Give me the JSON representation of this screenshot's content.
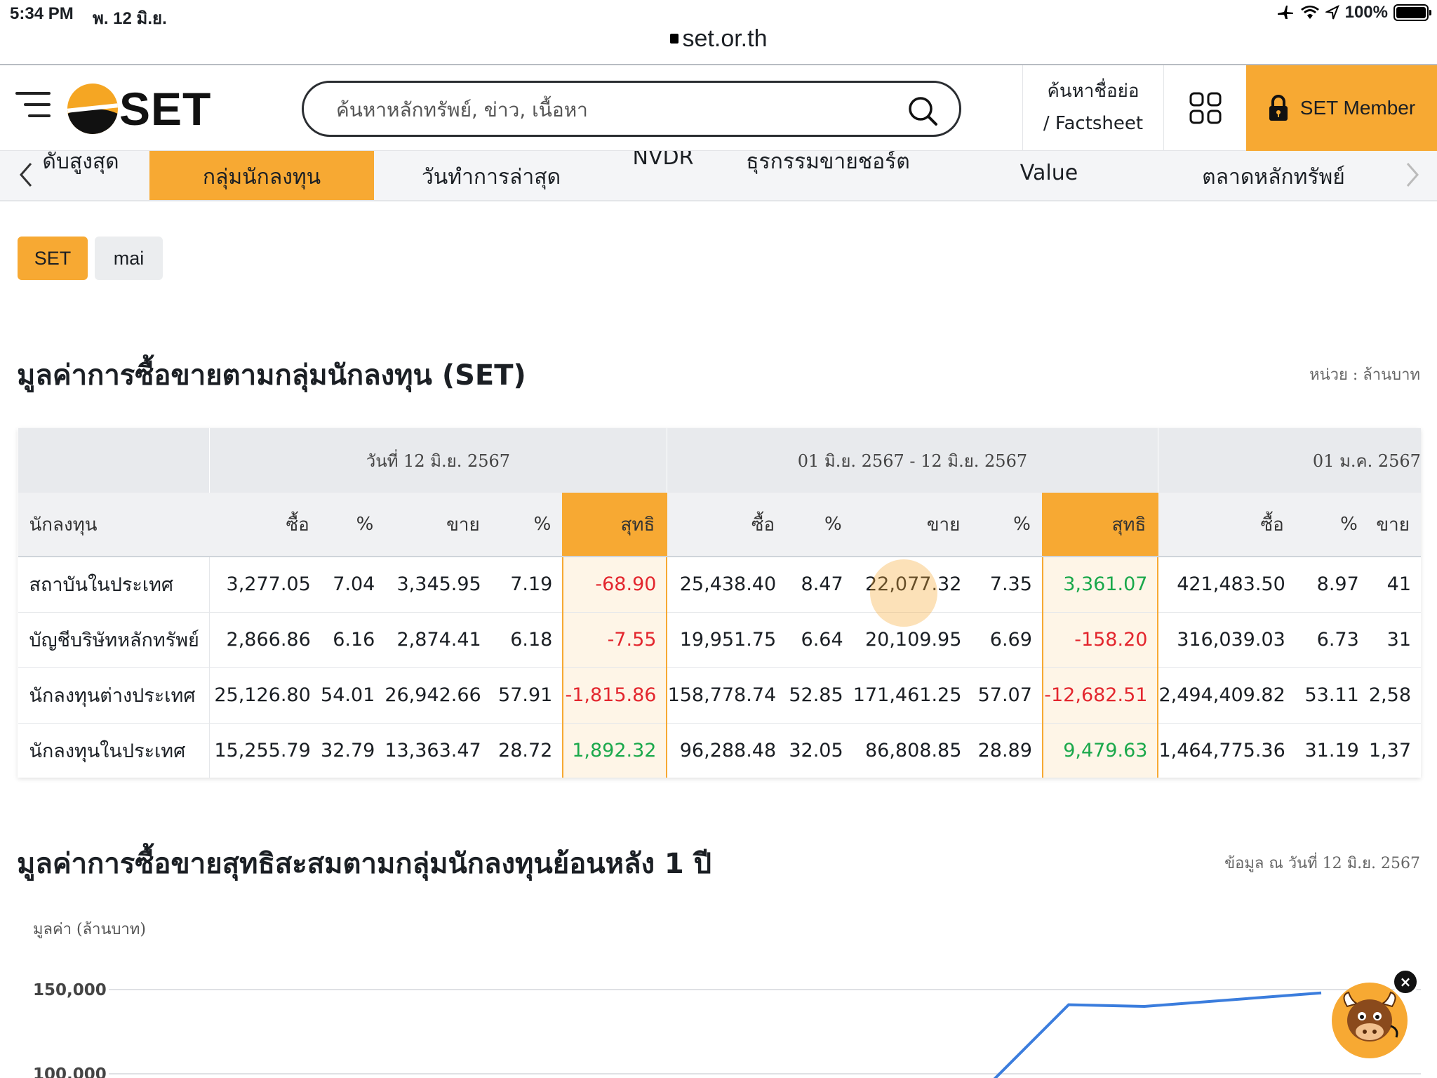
{
  "status_bar": {
    "time": "5:34 PM",
    "date": "พ. 12 มิ.ย.",
    "battery": "100%"
  },
  "browser": {
    "url": "set.or.th"
  },
  "header": {
    "logo_text": "SET",
    "search_placeholder": "ค้นหาหลักทรัพย์, ข่าว, เนื้อหา",
    "factsheet_line1": "ค้นหาชื่อย่อ",
    "factsheet_line2": "/ Factsheet",
    "member_label": "SET Member",
    "accent": "#f7a933"
  },
  "tabs": [
    {
      "top": "",
      "bottom": "ดับสูงสุด"
    },
    {
      "top": "",
      "bottom": "กลุ่มนักลงทุน",
      "active": true
    },
    {
      "top": "",
      "bottom": "วันทำการล่าสุด"
    },
    {
      "top": "",
      "bottom": "NVDR"
    },
    {
      "top": "",
      "bottom": "ธุรกรรมขายชอร์ต"
    },
    {
      "top": "",
      "bottom": "Value"
    },
    {
      "top": "",
      "bottom": "ตลาดหลักทรัพย์"
    }
  ],
  "market_toggle": {
    "set": "SET",
    "mai": "mai"
  },
  "table_section": {
    "title": "มูลค่าการซื้อขายตามกลุ่มนักลงทุน (SET)",
    "unit_note": "หน่วย : ล้านบาท",
    "groups": [
      "วันที่ 12 มิ.ย. 2567",
      "01 มิ.ย. 2567 - 12 มิ.ย. 2567",
      "01 ม.ค. 2567"
    ],
    "columns": [
      "นักลงทุน",
      "ซื้อ",
      "%",
      "ขาย",
      "%",
      "สุทธิ",
      "ซื้อ",
      "%",
      "ขาย",
      "%",
      "สุทธิ",
      "ซื้อ",
      "%",
      "ขาย"
    ],
    "rows": [
      [
        "สถาบันในประเทศ",
        "3,277.05",
        "7.04",
        "3,345.95",
        "7.19",
        "-68.90",
        "25,438.40",
        "8.47",
        "22,077.32",
        "7.35",
        "3,361.07",
        "421,483.50",
        "8.97",
        "41"
      ],
      [
        "บัญชีบริษัทหลักทรัพย์",
        "2,866.86",
        "6.16",
        "2,874.41",
        "6.18",
        "-7.55",
        "19,951.75",
        "6.64",
        "20,109.95",
        "6.69",
        "-158.20",
        "316,039.03",
        "6.73",
        "31"
      ],
      [
        "นักลงทุนต่างประเทศ",
        "25,126.80",
        "54.01",
        "26,942.66",
        "57.91",
        "-1,815.86",
        "158,778.74",
        "52.85",
        "171,461.25",
        "57.07",
        "-12,682.51",
        "2,494,409.82",
        "53.11",
        "2,58"
      ],
      [
        "นักลงทุนในประเทศ",
        "15,255.79",
        "32.79",
        "13,363.47",
        "28.72",
        "1,892.32",
        "96,288.48",
        "32.05",
        "86,808.85",
        "28.89",
        "9,479.63",
        "1,464,775.36",
        "31.19",
        "1,37"
      ]
    ],
    "net_colors": {
      "negative": "#e3262e",
      "positive": "#1aa84b"
    }
  },
  "chart_section": {
    "title": "มูลค่าการซื้อขายสุทธิสะสมตามกลุ่มนักลงทุนย้อนหลัง 1 ปี",
    "as_of_note": "ข้อมูล ณ วันที่ 12 มิ.ย. 2567",
    "ylabel": "มูลค่า (ล้านบาท)",
    "tick_150000": "150,000",
    "tick_100000": "100,000"
  },
  "chart_data": {
    "type": "line",
    "title": "",
    "xlabel": "",
    "ylabel": "มูลค่า (ล้านบาท)",
    "y_ticks": [
      150000,
      100000
    ],
    "ylim_visible": [
      95000,
      165000
    ],
    "x_range_index": [
      0,
      100
    ],
    "series": [
      {
        "color": "#3b7ddd",
        "points": [
          [
            70,
            96000
          ],
          [
            76,
            141000
          ],
          [
            82,
            140000
          ],
          [
            96,
            148000
          ]
        ]
      }
    ]
  },
  "chatbot": {
    "close_glyph": "×"
  }
}
